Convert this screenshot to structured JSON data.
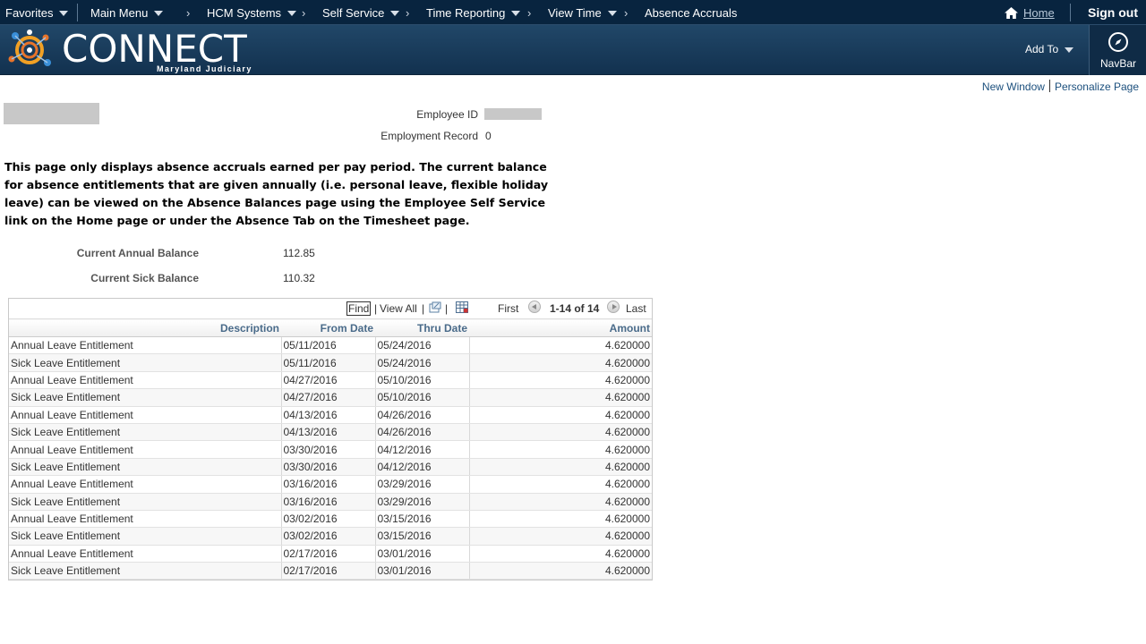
{
  "topnav": {
    "favorites": "Favorites",
    "main_menu": "Main Menu",
    "breadcrumbs": [
      "HCM Systems",
      "Self Service",
      "Time Reporting",
      "View Time",
      "Absence Accruals"
    ],
    "home": "Home",
    "sign_out": "Sign out"
  },
  "banner": {
    "logo_text": "CONNECT",
    "logo_subtitle": "Maryland Judiciary",
    "add_to": "Add To",
    "navbar": "NavBar"
  },
  "page_links": {
    "new_window": "New Window",
    "personalize": "Personalize Page"
  },
  "employee": {
    "id_label": "Employee ID",
    "record_label": "Employment Record",
    "record_value": "0"
  },
  "notice": "This page only displays absence accruals earned per pay period. The current balance for absence entitlements that are given annually (i.e. personal leave, flexible holiday leave) can be viewed on the Absence Balances page using the Employee Self Service link on the Home page or under the Absence Tab on the Timesheet page.",
  "balances": {
    "annual_label": "Current Annual Balance",
    "annual_value": "112.85",
    "sick_label": "Current Sick Balance",
    "sick_value": "110.32"
  },
  "grid": {
    "find": "Find",
    "view_all": "View All",
    "first": "First",
    "count": "1-14 of 14",
    "last": "Last",
    "columns": [
      "Description",
      "From Date",
      "Thru Date",
      "Amount"
    ],
    "rows": [
      [
        "Annual Leave Entitlement",
        "05/11/2016",
        "05/24/2016",
        "4.620000"
      ],
      [
        "Sick Leave Entitlement",
        "05/11/2016",
        "05/24/2016",
        "4.620000"
      ],
      [
        "Annual Leave Entitlement",
        "04/27/2016",
        "05/10/2016",
        "4.620000"
      ],
      [
        "Sick Leave Entitlement",
        "04/27/2016",
        "05/10/2016",
        "4.620000"
      ],
      [
        "Annual Leave Entitlement",
        "04/13/2016",
        "04/26/2016",
        "4.620000"
      ],
      [
        "Sick Leave Entitlement",
        "04/13/2016",
        "04/26/2016",
        "4.620000"
      ],
      [
        "Annual Leave Entitlement",
        "03/30/2016",
        "04/12/2016",
        "4.620000"
      ],
      [
        "Sick Leave Entitlement",
        "03/30/2016",
        "04/12/2016",
        "4.620000"
      ],
      [
        "Annual Leave Entitlement",
        "03/16/2016",
        "03/29/2016",
        "4.620000"
      ],
      [
        "Sick Leave Entitlement",
        "03/16/2016",
        "03/29/2016",
        "4.620000"
      ],
      [
        "Annual Leave Entitlement",
        "03/02/2016",
        "03/15/2016",
        "4.620000"
      ],
      [
        "Sick Leave Entitlement",
        "03/02/2016",
        "03/15/2016",
        "4.620000"
      ],
      [
        "Annual Leave Entitlement",
        "02/17/2016",
        "03/01/2016",
        "4.620000"
      ],
      [
        "Sick Leave Entitlement",
        "02/17/2016",
        "03/01/2016",
        "4.620000"
      ]
    ]
  }
}
